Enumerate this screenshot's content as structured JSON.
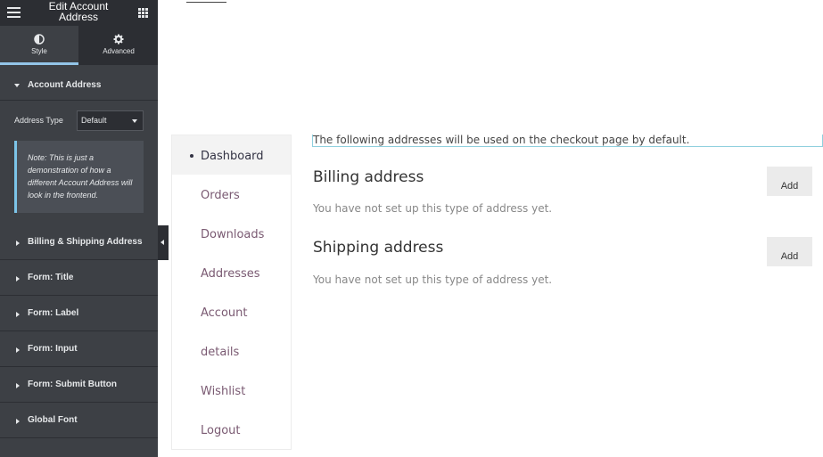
{
  "panel": {
    "title": "Edit Account Address",
    "tabs": [
      {
        "label": "Style",
        "icon": "contrast-icon"
      },
      {
        "label": "Advanced",
        "icon": "gear-icon"
      }
    ],
    "open_section": {
      "label": "Account Address",
      "address_type_label": "Address Type",
      "address_type_value": "Default",
      "note": "Note: This is just a demonstration of how a different Account Address will look in the frontend."
    },
    "sections": [
      "Billing & Shipping Address",
      "Form: Title",
      "Form: Label",
      "Form: Input",
      "Form: Submit Button",
      "Global Font"
    ]
  },
  "account": {
    "nav": [
      "Dashboard",
      "Orders",
      "Downloads",
      "Addresses",
      "Account",
      "details",
      "Wishlist",
      "Logout"
    ],
    "active_nav": "Dashboard",
    "intro": "The following addresses will be used on the checkout page by default.",
    "billing": {
      "title": "Billing address",
      "empty": "You have not set up this type of address yet.",
      "button": "Add"
    },
    "shipping": {
      "title": "Shipping address",
      "empty": "You have not set up this type of address yet.",
      "button": "Add"
    }
  },
  "colors": {
    "panel_bg": "#3d4045",
    "panel_dark": "#2c2e33",
    "accent": "#93c5e8",
    "link": "#7a5a72"
  }
}
